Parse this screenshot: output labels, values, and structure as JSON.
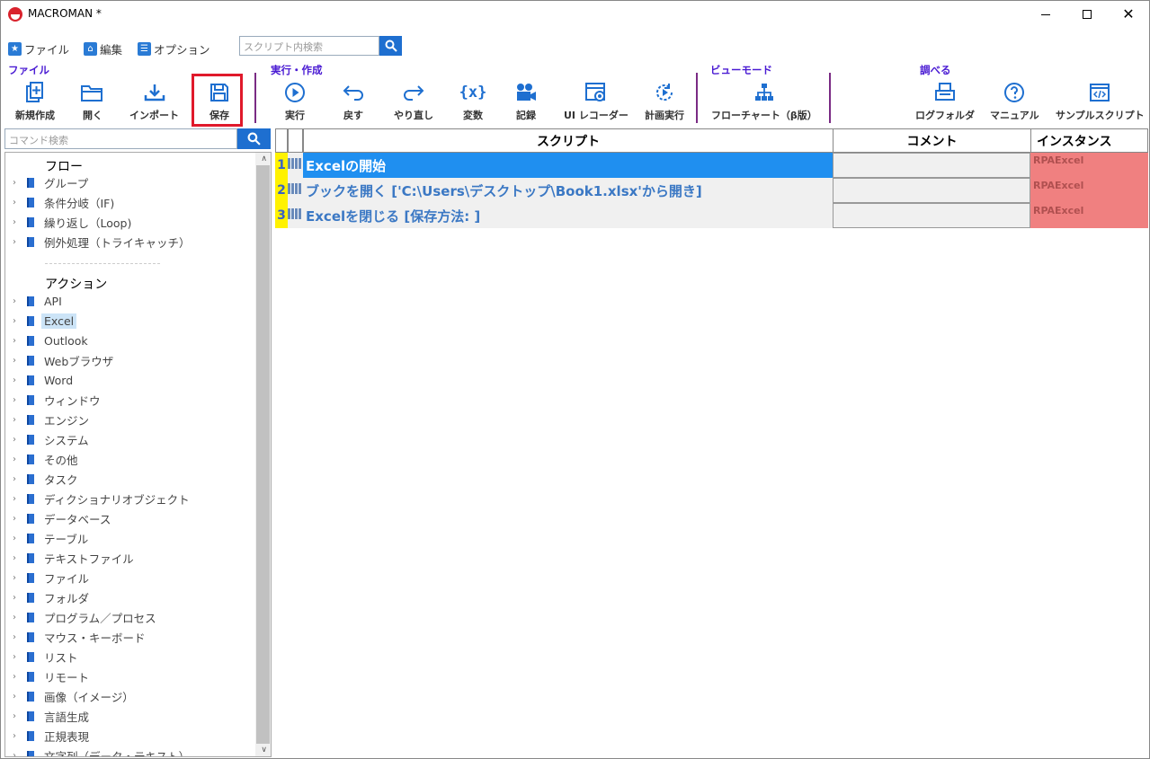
{
  "window": {
    "title": "MACROMAN *"
  },
  "menu": [
    {
      "label": "ファイル"
    },
    {
      "label": "編集"
    },
    {
      "label": "オプション"
    }
  ],
  "script_search": {
    "placeholder": "スクリプト内検索"
  },
  "groups": {
    "file": "ファイル",
    "run": "実行・作成",
    "view": "ビューモード",
    "lookup": "調べる"
  },
  "toolbar": {
    "new": "新規作成",
    "open": "開く",
    "import": "インポート",
    "save": "保存",
    "run": "実行",
    "undo": "戻す",
    "redo": "やり直し",
    "variables": "変数",
    "record": "記録",
    "ui_recorder": "UI レコーダー",
    "scheduled_run": "計画実行",
    "flowchart": "フローチャート（β版）",
    "log_folder": "ログフォルダ",
    "manual": "マニュアル",
    "sample_scripts": "サンプルスクリプト"
  },
  "command_search": {
    "placeholder": "コマンド検索"
  },
  "tree": {
    "flow_heading": "フロー",
    "flow_items": [
      "グループ",
      "条件分岐（IF)",
      "繰り返し（Loop)",
      "例外処理（トライキャッチ）"
    ],
    "action_heading": "アクション",
    "action_items": [
      "API",
      "Excel",
      "Outlook",
      "Webブラウザ",
      "Word",
      "ウィンドウ",
      "エンジン",
      "システム",
      "その他",
      "タスク",
      "ディクショナリオブジェクト",
      "データベース",
      "テーブル",
      "テキストファイル",
      "ファイル",
      "フォルダ",
      "プログラム／プロセス",
      "マウス・キーボード",
      "リスト",
      "リモート",
      "画像（イメージ）",
      "言語生成",
      "正規表現",
      "文字列（データ・テキスト）"
    ],
    "selected": "Excel"
  },
  "grid": {
    "headers": {
      "script": "スクリプト",
      "comment": "コメント",
      "instance": "インスタンス"
    },
    "rows": [
      {
        "num": "1",
        "script": "Excelの開始",
        "comment": "",
        "instance": "RPAExcel"
      },
      {
        "num": "2",
        "script": "ブックを開く ['C:\\Users\\デスクトップ\\Book1.xlsx'から開き]",
        "comment": "",
        "instance": "RPAExcel"
      },
      {
        "num": "3",
        "script": "Excelを閉じる [保存方法: ]",
        "comment": "",
        "instance": "RPAExcel"
      }
    ]
  },
  "colors": {
    "accent": "#1e6fd0",
    "group_label": "#4a1bd3",
    "highlight": "#e0192b",
    "instance_bg": "#f08080",
    "row_num_bg": "#fff200"
  }
}
